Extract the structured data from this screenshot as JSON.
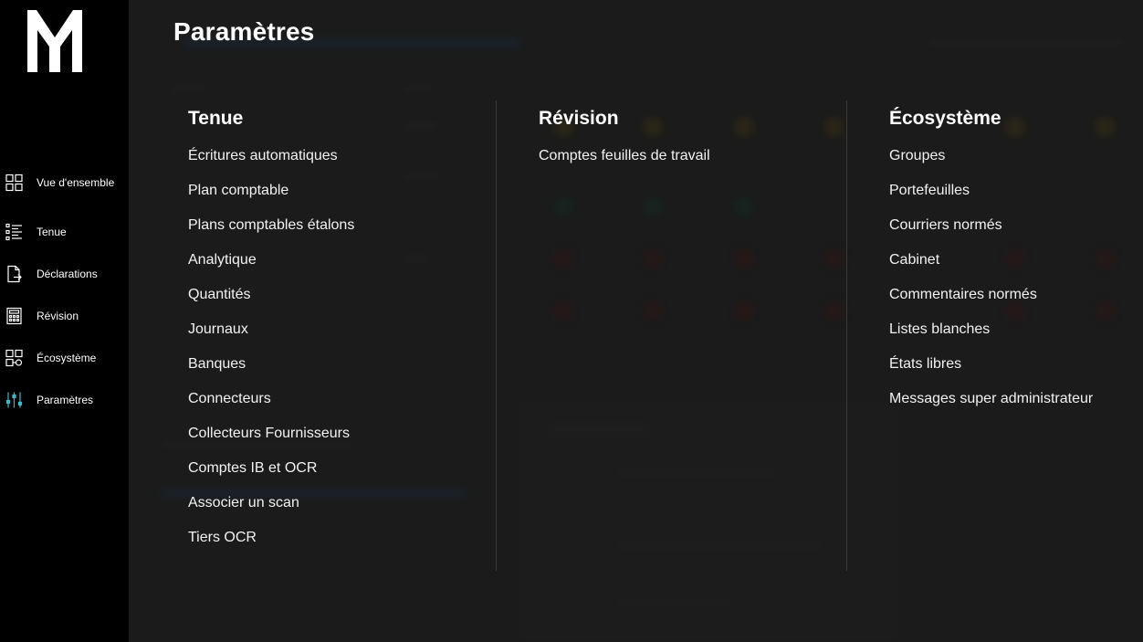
{
  "page": {
    "title": "Paramètres"
  },
  "sidebar": {
    "logo": "M",
    "items": [
      {
        "label": "Vue d'ensemble",
        "icon": "dashboard-grid-icon"
      },
      {
        "label": "Tenue",
        "icon": "list-icon"
      },
      {
        "label": "Déclarations",
        "icon": "document-export-icon"
      },
      {
        "label": "Révision",
        "icon": "calculator-icon"
      },
      {
        "label": "Écosystème",
        "icon": "ecosystem-icon"
      },
      {
        "label": "Paramètres",
        "icon": "sliders-icon",
        "active": true
      }
    ]
  },
  "menu": {
    "tenue": {
      "title": "Tenue",
      "items": [
        "Écritures automatiques",
        "Plan comptable",
        "Plans comptables étalons",
        "Analytique",
        "Quantités",
        "Journaux",
        "Banques",
        "Connecteurs",
        "Collecteurs Fournisseurs",
        "Comptes IB et OCR",
        "Associer un scan",
        "Tiers OCR"
      ]
    },
    "revision": {
      "title": "Révision",
      "items": [
        "Comptes feuilles de travail"
      ]
    },
    "ecosysteme": {
      "title": "Écosystème",
      "items": [
        "Groupes",
        "Portefeuilles",
        "Courriers normés",
        "Cabinet",
        "Commentaires normés",
        "Listes blanches",
        "États libres",
        "Messages super administrateur"
      ]
    }
  },
  "colors": {
    "sidebar_bg": "#000000",
    "content_bg": "#1f1f1f",
    "active_icon": "#3fb6c8",
    "divider": "#3a3a3a"
  }
}
